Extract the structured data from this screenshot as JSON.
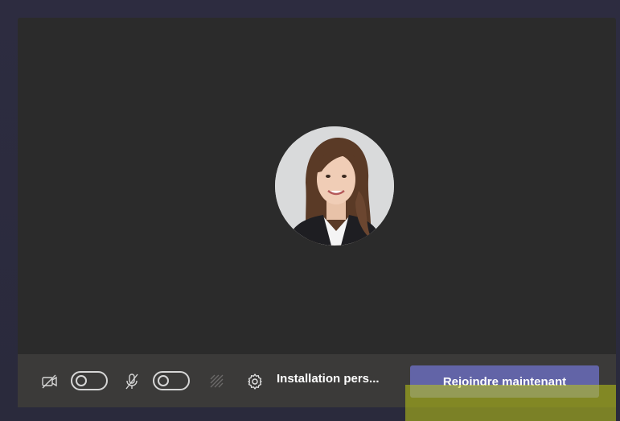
{
  "toolbar": {
    "camera": {
      "icon": "camera-off-icon",
      "state": "off"
    },
    "microphone": {
      "icon": "mic-off-icon",
      "state": "off"
    },
    "background_effects": {
      "icon": "background-effects-icon",
      "enabled": false
    },
    "device_settings": {
      "icon": "gear-icon",
      "label": "Installation pers..."
    },
    "join_button_label": "Rejoindre maintenant"
  },
  "colors": {
    "preview_bg": "#2b2b2b",
    "toolbar_bg": "#3b3a39",
    "accent": "#6264a7",
    "highlight": "#bec814"
  }
}
